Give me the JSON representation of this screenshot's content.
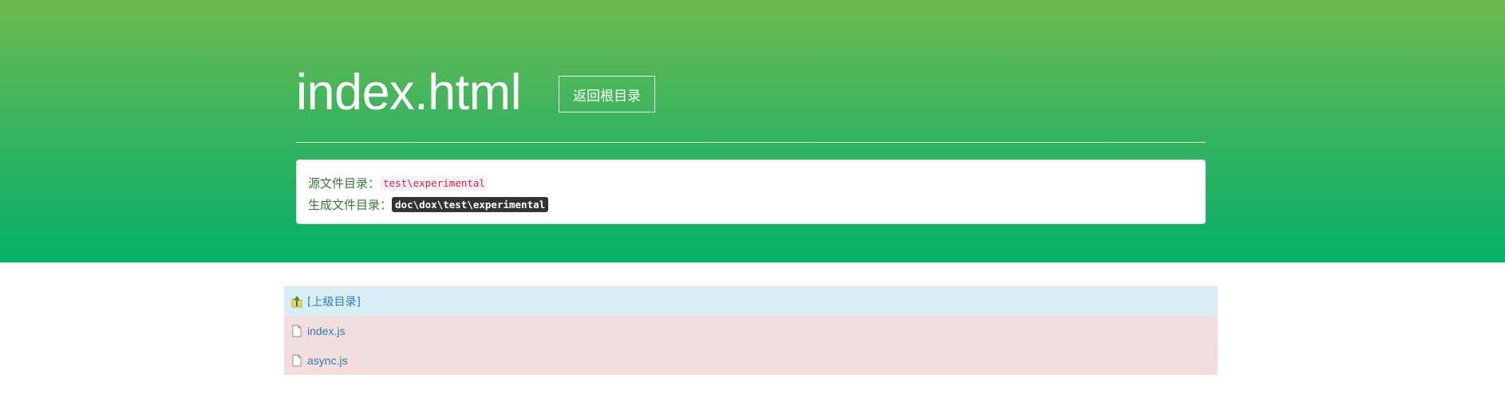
{
  "header": {
    "title": "index.html",
    "back_root_label": "返回根目录"
  },
  "info": {
    "source_label": "源文件目录：",
    "source_path": "test\\experimental",
    "output_label": "生成文件目录：",
    "output_path": "doc\\dox\\test\\experimental"
  },
  "files": {
    "parent": {
      "label": "[上级目录]",
      "icon": "folder-up-icon"
    },
    "items": [
      {
        "name": "index.js",
        "icon": "file-icon"
      },
      {
        "name": "async.js",
        "icon": "file-icon"
      }
    ]
  },
  "colors": {
    "hero_top": "#6dbb4f",
    "hero_bottom": "#05b169",
    "parent_row_bg": "#d9edf7",
    "file_row_bg": "#f2dede",
    "link": "#337ab7",
    "info_text": "#3c763d"
  }
}
